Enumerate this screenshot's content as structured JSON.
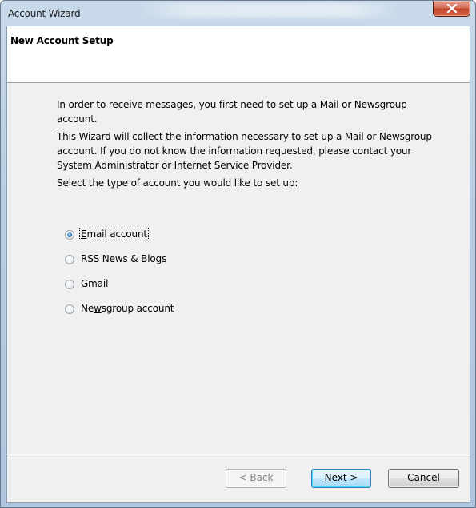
{
  "window": {
    "title": "Account Wizard",
    "colors": {
      "titlebar": "#b9cde2",
      "close_button": "#c2432a",
      "dialog_bg": "#f0f0f0",
      "header_bg": "#ffffff"
    }
  },
  "header": {
    "title": "New Account Setup"
  },
  "body": {
    "paragraph1": "In order to receive messages, you first need to set up a Mail or Newsgroup account.",
    "paragraph2": "This Wizard will collect the information necessary to set up a Mail or Newsgroup account. If you do not know the information requested, please contact your System Administrator or Internet Service Provider.",
    "prompt": "Select the type of account you would like to set up:"
  },
  "account_types": {
    "selected": "Email account",
    "options": [
      {
        "pre": "",
        "key": "E",
        "post": "mail account",
        "checked": true
      },
      {
        "pre": "",
        "key": "",
        "post": "RSS News & Blogs",
        "checked": false
      },
      {
        "pre": "",
        "key": "",
        "post": "Gmail",
        "checked": false
      },
      {
        "pre": "Ne",
        "key": "w",
        "post": "sgroup account",
        "checked": false
      }
    ]
  },
  "buttons": {
    "back": {
      "pre": "< ",
      "key": "B",
      "post": "ack",
      "enabled": false
    },
    "next": {
      "pre": "",
      "key": "N",
      "post": "ext >",
      "enabled": true
    },
    "cancel": {
      "label": "Cancel",
      "enabled": true
    }
  },
  "icons": {
    "close": "close-x-icon",
    "radio": "radio-button-icon"
  }
}
